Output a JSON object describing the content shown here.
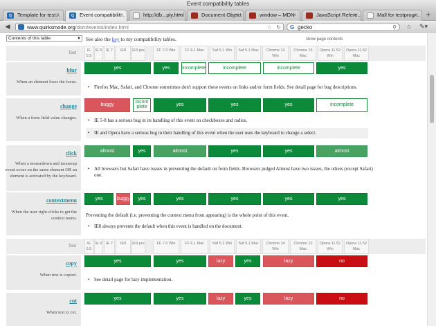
{
  "window": {
    "title": "Event compatibility tables"
  },
  "tabs": [
    {
      "label": "Template for test...",
      "icon": "quirksmode-favicon"
    },
    {
      "label": "Event compatibilit...",
      "icon": "quirksmode-favicon"
    },
    {
      "label": "http://db...ply.html",
      "icon": "blank-page-icon"
    },
    {
      "label": "Document Object ...",
      "icon": "mdn-dino-favicon"
    },
    {
      "label": "window – MDN",
      "icon": "mdn-dino-favicon"
    },
    {
      "label": "JavaScript Refere...",
      "icon": "mdn-dino-favicon"
    },
    {
      "label": "Mall for testprogr...",
      "icon": "blank-page-icon"
    }
  ],
  "toolbar": {
    "url_host": "www.quirksmode.org",
    "url_path": "/dom/events/index.html",
    "search_value": "gecko",
    "search_engine": "G"
  },
  "page": {
    "toc_select": "Contents of this table",
    "intro_prefix": "See also the",
    "intro_link": "key",
    "intro_suffix": "to my compatibility tables.",
    "show_contents": "show page contents",
    "header_test": "Test",
    "browsers": [
      "IE 5.5",
      "IE 6",
      "IE 7",
      "IE8",
      "IE9 pre",
      "FF 7.0 Win",
      "FF 6.1 Mac",
      "Saf 5.1 Win",
      "Saf 5.1 Mac",
      "Chrome 14 Win",
      "Chrome 13 Mac",
      "Opera 11.52 Win",
      "Opera 11.52 Mac"
    ],
    "browsers2": [
      "IE 5.5",
      "IE 6",
      "IE 7",
      "IE8",
      "IE9 pre",
      "FF 7.0 Win",
      "FF 6.1 Mac",
      "Saf 5.1 Win",
      "Saf 5.1 Mac",
      "Chrome 14 Win",
      "Chrome 13 Mac",
      "Opera 11.52 Win",
      "Opera 11.52 Mac"
    ]
  },
  "events": [
    {
      "name": "blur",
      "desc": "When an element loses the focus.",
      "cells": [
        "yes",
        "yes",
        "incomplete",
        "incomplete",
        "incomplete",
        "yes"
      ],
      "notes": [
        "Firefox Mac, Safari, and Chrome sometimes don't support these events on links and/or form fields. See detail page for bug descriptions."
      ]
    },
    {
      "name": "change",
      "desc": "When a form field value changes.",
      "cells": [
        "buggy",
        "incom plete",
        "yes",
        "yes",
        "yes",
        "incomplete"
      ],
      "notes": [
        "IE 5-8 has a serious bug in its handling of this event on checkboxes and radios.",
        "IE and Opera have a serious bug in their handling of this event when the user uses the keyboard to change a select."
      ]
    },
    {
      "name": "click",
      "desc": "When a mousedown and mouseup event occur on the same element OR an element is activated by the keyboard.",
      "cells": [
        "almost",
        "yes",
        "almost",
        "yes",
        "yes",
        "almost"
      ],
      "notes": [
        "All browsers but Safari have issues in preventing the default on form fields. Browsers judged Almost have two issues, the others (except Safari) one."
      ]
    },
    {
      "name": "contextmenu",
      "desc": "When the user right-clicks to get the context menu.",
      "cells": [
        "yes",
        "buggy",
        "yes",
        "yes",
        "yes",
        "yes",
        "yes"
      ],
      "note_plain": "Preventing the default (i.e. preventing the context menu from appearing) is the whole point of this event.",
      "notes": [
        "IE8 always prevents the default when this event is handled on the document."
      ]
    },
    {
      "name": "copy",
      "desc": "When text is copied.",
      "cells": [
        "yes",
        "yes",
        "lazy",
        "yes",
        "lazy",
        "no"
      ],
      "notes": [
        "See detail page for lazy implementation."
      ]
    },
    {
      "name": "cut",
      "desc": "When text is cut.",
      "cells": [
        "yes",
        "yes",
        "lazy",
        "yes",
        "lazy",
        "no"
      ],
      "notes": []
    }
  ],
  "colors": {
    "yes": "#0c8a3a",
    "almost": "#49a262",
    "buggy": "#d9565c",
    "lazy": "#d9565c",
    "no": "#c90d12",
    "link": "#2a8a9f"
  }
}
